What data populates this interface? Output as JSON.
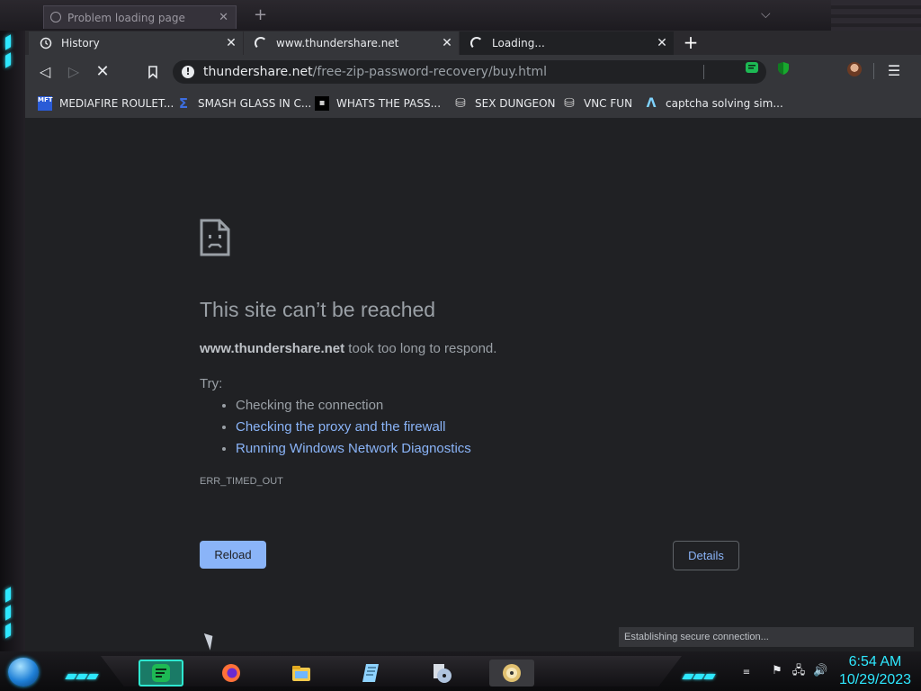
{
  "background_window": {
    "tab_title": "Problem loading page",
    "close_glyph": "✕",
    "plus_glyph": "+",
    "chevron_glyph": "⌵"
  },
  "tabs": [
    {
      "title": "History",
      "icon": "history-icon",
      "close": "✕"
    },
    {
      "title": "www.thundershare.net",
      "icon": "loading-spinner-icon",
      "close": "✕"
    },
    {
      "title": "Loading...",
      "icon": "loading-spinner-icon",
      "close": "✕"
    }
  ],
  "new_tab_glyph": "+",
  "toolbar": {
    "back_glyph": "◁",
    "forward_glyph": "▷",
    "stop_glyph": "✕",
    "bookmark_glyph": "🔖",
    "menu_glyph": "☰"
  },
  "omnibox": {
    "info_glyph": "!",
    "host": "thundershare.net",
    "path": "/free-zip-password-recovery/buy.html"
  },
  "extensions": [
    {
      "name": "chat-extension-icon",
      "color": "#1db954"
    },
    {
      "name": "shield-extension-icon",
      "color": "#18a82e"
    }
  ],
  "bookmarks": [
    {
      "label": "MEDIAFIRE ROULET...",
      "icon": "mediafire-icon",
      "icon_text": "MFT",
      "color": "#2a5bd7"
    },
    {
      "label": "SMASH GLASS IN C...",
      "icon": "sigma-icon",
      "icon_text": "Σ",
      "color": "#3d6ee0"
    },
    {
      "label": "WHATS THE PASS...",
      "icon": "lock-page-icon",
      "icon_text": "▪",
      "color": "#000000"
    },
    {
      "label": "SEX DUNGEON",
      "icon": "stack-icon",
      "icon_text": "⛁",
      "color": "#d0d0d0"
    },
    {
      "label": "VNC FUN",
      "icon": "stack-icon",
      "icon_text": "⛁",
      "color": "#d0d0d0"
    },
    {
      "label": "captcha solving sim...",
      "icon": "lambda-icon",
      "icon_text": "Λ",
      "color": "#7fd3ff"
    }
  ],
  "error_page": {
    "title": "This site can’t be reached",
    "host": "www.thundershare.net",
    "message_rest": " took too long to respond.",
    "try_label": "Try:",
    "suggestions": [
      "Checking the connection",
      "Checking the proxy and the firewall",
      "Running Windows Network Diagnostics"
    ],
    "error_code": "ERR_TIMED_OUT",
    "reload_label": "Reload",
    "details_label": "Details"
  },
  "status_bar": "Establishing secure connection...",
  "taskbar": {
    "apps": [
      {
        "name": "chat-app-icon",
        "color": "#1db954"
      },
      {
        "name": "firefox-icon",
        "color": "#ff7139"
      },
      {
        "name": "file-explorer-icon",
        "color": "#f2c94c"
      },
      {
        "name": "notepad-icon",
        "color": "#8fd3ff"
      },
      {
        "name": "media-disc-icon",
        "color": "#b0c4de"
      },
      {
        "name": "dvd-icon",
        "color": "#e0c070"
      }
    ],
    "tray": {
      "flag_glyph": "⚑",
      "network_glyph": "🖧",
      "volume_glyph": "🔊"
    },
    "time": "6:54 AM",
    "date": "10/29/2023"
  },
  "colors": {
    "accent_cyan": "#2ee8ff",
    "link_blue": "#8ab4f8",
    "page_bg": "#202124",
    "toolbar_bg": "#35363a"
  }
}
